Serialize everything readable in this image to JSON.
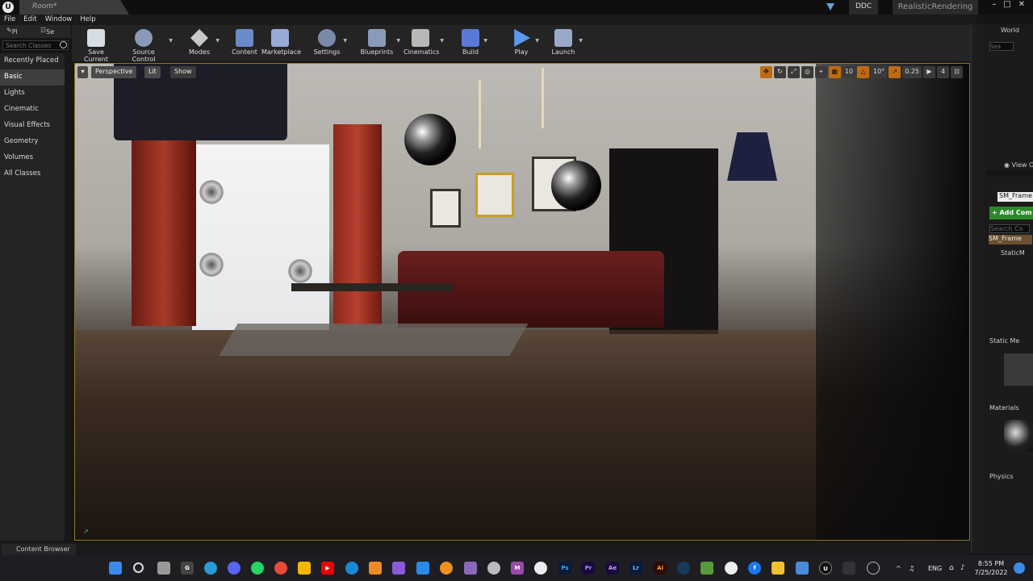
{
  "window": {
    "tab_title": "Room*",
    "ddc_label": "DDC",
    "project_name": "RealisticRendering"
  },
  "menu": [
    "File",
    "Edit",
    "Window",
    "Help"
  ],
  "modes": {
    "tab1": "Pl",
    "tab2": "Se",
    "search_placeholder": "Search Classes",
    "categories": [
      "Recently Placed",
      "Basic",
      "Lights",
      "Cinematic",
      "Visual Effects",
      "Geometry",
      "Volumes",
      "All Classes"
    ],
    "active": "Basic"
  },
  "toolbar": [
    {
      "label": "Save Current",
      "icon": "save-icon",
      "dropdown": false
    },
    {
      "label": "Source Control",
      "icon": "source-control-icon",
      "dropdown": true
    },
    {
      "label": "Modes",
      "icon": "modes-icon",
      "dropdown": true
    },
    {
      "label": "Content",
      "icon": "content-icon",
      "dropdown": false
    },
    {
      "label": "Marketplace",
      "icon": "marketplace-icon",
      "dropdown": false
    },
    {
      "label": "Settings",
      "icon": "settings-icon",
      "dropdown": true
    },
    {
      "label": "Blueprints",
      "icon": "blueprints-icon",
      "dropdown": true
    },
    {
      "label": "Cinematics",
      "icon": "cinematics-icon",
      "dropdown": true
    },
    {
      "label": "Build",
      "icon": "build-icon",
      "dropdown": true
    },
    {
      "label": "Play",
      "icon": "play-icon",
      "dropdown": true
    },
    {
      "label": "Launch",
      "icon": "launch-icon",
      "dropdown": true
    }
  ],
  "viewport": {
    "view_mode": "Perspective",
    "lighting": "Lit",
    "show": "Show",
    "grid_snap": "10",
    "rotate_snap": "10°",
    "scale_snap": "0.25",
    "camera_speed": "4"
  },
  "outliner": {
    "title": "World",
    "search_placeholder": "Sea",
    "view_options": "View O"
  },
  "details": {
    "name_field": "SM_Frame",
    "add_component": "+ Add Com",
    "search_placeholder": "Search Co",
    "component_name": "SM_Frame",
    "static_mesh_row": "StaticM",
    "sections": [
      "Static Me",
      "Materials",
      "Physics"
    ]
  },
  "bottom": {
    "content_browser": "Content Browser"
  },
  "taskbar": {
    "language": "ENG",
    "time": "8:55 PM",
    "date": "7/25/2022",
    "apps": [
      "start",
      "search",
      "taskview",
      "g",
      "telegram",
      "discord",
      "whatsapp",
      "chrome",
      "drive",
      "youtube",
      "edge",
      "sublime",
      "vs",
      "vscode",
      "blender",
      "notes",
      "fusion",
      "m",
      "g2",
      "ps",
      "pr",
      "ae",
      "lr",
      "ai",
      "steam",
      "minecraft",
      "wp",
      "facebook",
      "explorer",
      "photos",
      "unreal",
      "capture",
      "misc"
    ]
  }
}
